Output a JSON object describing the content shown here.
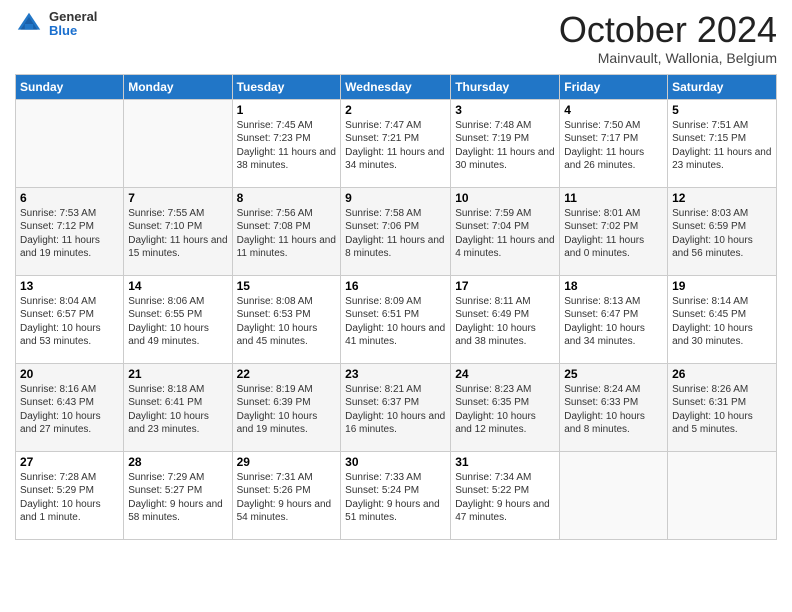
{
  "header": {
    "logo": {
      "general": "General",
      "blue": "Blue"
    },
    "title": "October 2024",
    "location": "Mainvault, Wallonia, Belgium"
  },
  "days_of_week": [
    "Sunday",
    "Monday",
    "Tuesday",
    "Wednesday",
    "Thursday",
    "Friday",
    "Saturday"
  ],
  "weeks": [
    [
      {
        "day": "",
        "info": ""
      },
      {
        "day": "",
        "info": ""
      },
      {
        "day": "1",
        "info": "Sunrise: 7:45 AM\nSunset: 7:23 PM\nDaylight: 11 hours and 38 minutes."
      },
      {
        "day": "2",
        "info": "Sunrise: 7:47 AM\nSunset: 7:21 PM\nDaylight: 11 hours and 34 minutes."
      },
      {
        "day": "3",
        "info": "Sunrise: 7:48 AM\nSunset: 7:19 PM\nDaylight: 11 hours and 30 minutes."
      },
      {
        "day": "4",
        "info": "Sunrise: 7:50 AM\nSunset: 7:17 PM\nDaylight: 11 hours and 26 minutes."
      },
      {
        "day": "5",
        "info": "Sunrise: 7:51 AM\nSunset: 7:15 PM\nDaylight: 11 hours and 23 minutes."
      }
    ],
    [
      {
        "day": "6",
        "info": "Sunrise: 7:53 AM\nSunset: 7:12 PM\nDaylight: 11 hours and 19 minutes."
      },
      {
        "day": "7",
        "info": "Sunrise: 7:55 AM\nSunset: 7:10 PM\nDaylight: 11 hours and 15 minutes."
      },
      {
        "day": "8",
        "info": "Sunrise: 7:56 AM\nSunset: 7:08 PM\nDaylight: 11 hours and 11 minutes."
      },
      {
        "day": "9",
        "info": "Sunrise: 7:58 AM\nSunset: 7:06 PM\nDaylight: 11 hours and 8 minutes."
      },
      {
        "day": "10",
        "info": "Sunrise: 7:59 AM\nSunset: 7:04 PM\nDaylight: 11 hours and 4 minutes."
      },
      {
        "day": "11",
        "info": "Sunrise: 8:01 AM\nSunset: 7:02 PM\nDaylight: 11 hours and 0 minutes."
      },
      {
        "day": "12",
        "info": "Sunrise: 8:03 AM\nSunset: 6:59 PM\nDaylight: 10 hours and 56 minutes."
      }
    ],
    [
      {
        "day": "13",
        "info": "Sunrise: 8:04 AM\nSunset: 6:57 PM\nDaylight: 10 hours and 53 minutes."
      },
      {
        "day": "14",
        "info": "Sunrise: 8:06 AM\nSunset: 6:55 PM\nDaylight: 10 hours and 49 minutes."
      },
      {
        "day": "15",
        "info": "Sunrise: 8:08 AM\nSunset: 6:53 PM\nDaylight: 10 hours and 45 minutes."
      },
      {
        "day": "16",
        "info": "Sunrise: 8:09 AM\nSunset: 6:51 PM\nDaylight: 10 hours and 41 minutes."
      },
      {
        "day": "17",
        "info": "Sunrise: 8:11 AM\nSunset: 6:49 PM\nDaylight: 10 hours and 38 minutes."
      },
      {
        "day": "18",
        "info": "Sunrise: 8:13 AM\nSunset: 6:47 PM\nDaylight: 10 hours and 34 minutes."
      },
      {
        "day": "19",
        "info": "Sunrise: 8:14 AM\nSunset: 6:45 PM\nDaylight: 10 hours and 30 minutes."
      }
    ],
    [
      {
        "day": "20",
        "info": "Sunrise: 8:16 AM\nSunset: 6:43 PM\nDaylight: 10 hours and 27 minutes."
      },
      {
        "day": "21",
        "info": "Sunrise: 8:18 AM\nSunset: 6:41 PM\nDaylight: 10 hours and 23 minutes."
      },
      {
        "day": "22",
        "info": "Sunrise: 8:19 AM\nSunset: 6:39 PM\nDaylight: 10 hours and 19 minutes."
      },
      {
        "day": "23",
        "info": "Sunrise: 8:21 AM\nSunset: 6:37 PM\nDaylight: 10 hours and 16 minutes."
      },
      {
        "day": "24",
        "info": "Sunrise: 8:23 AM\nSunset: 6:35 PM\nDaylight: 10 hours and 12 minutes."
      },
      {
        "day": "25",
        "info": "Sunrise: 8:24 AM\nSunset: 6:33 PM\nDaylight: 10 hours and 8 minutes."
      },
      {
        "day": "26",
        "info": "Sunrise: 8:26 AM\nSunset: 6:31 PM\nDaylight: 10 hours and 5 minutes."
      }
    ],
    [
      {
        "day": "27",
        "info": "Sunrise: 7:28 AM\nSunset: 5:29 PM\nDaylight: 10 hours and 1 minute."
      },
      {
        "day": "28",
        "info": "Sunrise: 7:29 AM\nSunset: 5:27 PM\nDaylight: 9 hours and 58 minutes."
      },
      {
        "day": "29",
        "info": "Sunrise: 7:31 AM\nSunset: 5:26 PM\nDaylight: 9 hours and 54 minutes."
      },
      {
        "day": "30",
        "info": "Sunrise: 7:33 AM\nSunset: 5:24 PM\nDaylight: 9 hours and 51 minutes."
      },
      {
        "day": "31",
        "info": "Sunrise: 7:34 AM\nSunset: 5:22 PM\nDaylight: 9 hours and 47 minutes."
      },
      {
        "day": "",
        "info": ""
      },
      {
        "day": "",
        "info": ""
      }
    ]
  ]
}
